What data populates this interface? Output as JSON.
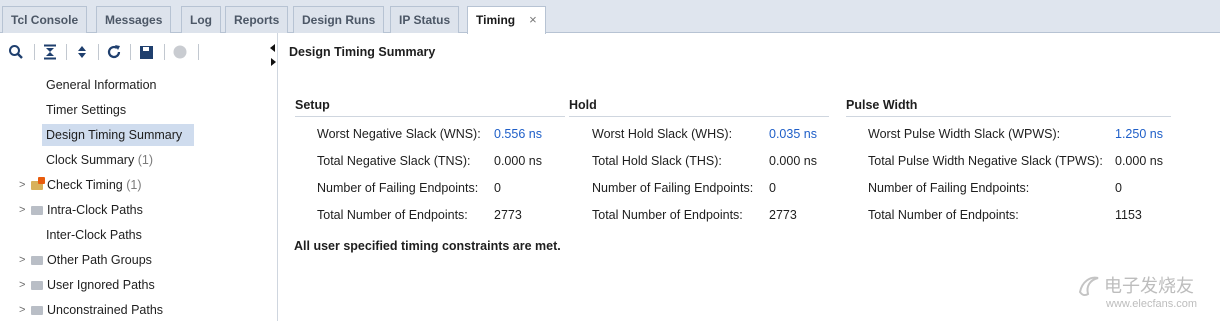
{
  "tabs": [
    {
      "label": "Tcl Console",
      "active": false
    },
    {
      "label": "Messages",
      "active": false
    },
    {
      "label": "Log",
      "active": false
    },
    {
      "label": "Reports",
      "active": false
    },
    {
      "label": "Design Runs",
      "active": false
    },
    {
      "label": "IP Status",
      "active": false
    },
    {
      "label": "Timing",
      "active": true,
      "close": "×"
    }
  ],
  "toolbar": {
    "icons": [
      "search-icon",
      "collapse-all-icon",
      "expand-all-icon",
      "refresh-icon",
      "save-icon",
      "stop-icon"
    ]
  },
  "sidebar": {
    "items": [
      {
        "label": "General Information",
        "count": ""
      },
      {
        "label": "Timer Settings",
        "count": ""
      },
      {
        "label": "Design Timing Summary",
        "count": "",
        "selected": true
      },
      {
        "label": "Clock Summary",
        "count": "(1)"
      },
      {
        "label": "Check Timing",
        "count": "(1)",
        "expandable": true,
        "icon": "warning-folder-icon"
      },
      {
        "label": "Intra-Clock Paths",
        "count": "",
        "expandable": true,
        "icon": "folder-icon"
      },
      {
        "label": "Inter-Clock Paths",
        "count": ""
      },
      {
        "label": "Other Path Groups",
        "count": "",
        "expandable": true,
        "icon": "folder-icon"
      },
      {
        "label": "User Ignored Paths",
        "count": "",
        "expandable": true,
        "icon": "folder-icon"
      },
      {
        "label": "Unconstrained Paths",
        "count": "",
        "expandable": true,
        "icon": "folder-icon"
      }
    ]
  },
  "main": {
    "title": "Design Timing Summary",
    "setup": {
      "title": "Setup",
      "rows": [
        {
          "label": "Worst Negative Slack (WNS):",
          "value": "0.556 ns",
          "link": true
        },
        {
          "label": "Total Negative Slack (TNS):",
          "value": "0.000 ns",
          "link": false
        },
        {
          "label": "Number of Failing Endpoints:",
          "value": "0",
          "link": false
        },
        {
          "label": "Total Number of Endpoints:",
          "value": "2773",
          "link": false
        }
      ]
    },
    "hold": {
      "title": "Hold",
      "rows": [
        {
          "label": "Worst Hold Slack (WHS):",
          "value": "0.035 ns",
          "link": true
        },
        {
          "label": "Total Hold Slack (THS):",
          "value": "0.000 ns",
          "link": false
        },
        {
          "label": "Number of Failing Endpoints:",
          "value": "0",
          "link": false
        },
        {
          "label": "Total Number of Endpoints:",
          "value": "2773",
          "link": false
        }
      ]
    },
    "pulse": {
      "title": "Pulse Width",
      "rows": [
        {
          "label": "Worst Pulse Width Slack (WPWS):",
          "value": "1.250 ns",
          "link": true
        },
        {
          "label": "Total Pulse Width Negative Slack (TPWS):",
          "value": "0.000 ns",
          "link": false
        },
        {
          "label": "Number of Failing Endpoints:",
          "value": "0",
          "link": false
        },
        {
          "label": "Total Number of Endpoints:",
          "value": "1153",
          "link": false
        }
      ]
    },
    "footnote": "All user specified timing constraints are met."
  },
  "watermark": {
    "main": "电子发烧友",
    "sub": "www.elecfans.com"
  },
  "colors": {
    "link": "#1f5fc8",
    "selected_bg": "#cfdcee",
    "tabbar_bg": "#dfe5ee"
  }
}
